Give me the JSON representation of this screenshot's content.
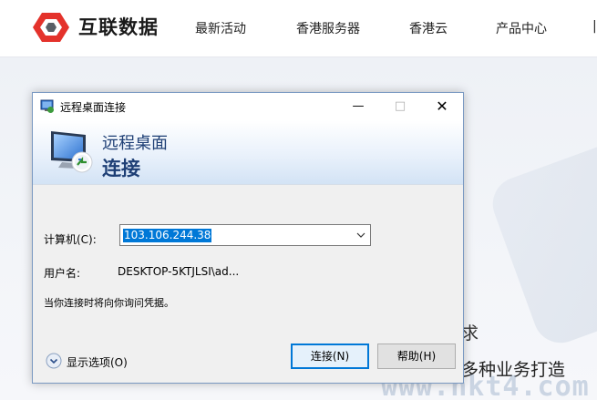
{
  "site": {
    "brand": "互联数据",
    "nav": [
      "最新活动",
      "香港服务器",
      "香港云",
      "产品中心"
    ],
    "hero_char": "求",
    "hero_line": "多种业务打造",
    "watermark": "www.hkt4.com"
  },
  "dialog": {
    "title": "远程桌面连接",
    "banner_line1": "远程桌面",
    "banner_line2": "连接",
    "computer_label": "计算机(C):",
    "computer_value": "103.106.244.38",
    "user_label": "用户名:",
    "user_value": "DESKTOP-5KTJLSI\\ad...",
    "hint": "当你连接时将向你询问凭据。",
    "show_options": "显示选项(O)",
    "connect_button": "连接(N)",
    "help_button": "帮助(H)"
  },
  "colors": {
    "accent": "#0078d7",
    "banner_text": "#1e3f75",
    "logo_red": "#e4322b"
  },
  "icons": [
    "logo-icon",
    "rdp-small-icon",
    "minimize-icon",
    "maximize-icon",
    "close-icon",
    "rdp-monitor-icon",
    "chevron-down-icon",
    "expand-options-icon"
  ]
}
